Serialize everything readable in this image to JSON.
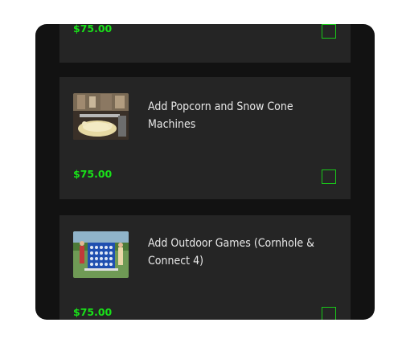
{
  "items": [
    {
      "title": "",
      "price": "$75.00",
      "checked": false,
      "image": ""
    },
    {
      "title": "Add Popcorn and Snow Cone Machines",
      "price": "$75.00",
      "checked": false,
      "image": "popcorn-machine-photo"
    },
    {
      "title": "Add Outdoor Games (Cornhole & Connect 4)",
      "price": "$75.00",
      "checked": false,
      "image": "outdoor-games-photo"
    }
  ],
  "colors": {
    "price": "#19e019",
    "card": "#252525",
    "background": "#121212"
  }
}
